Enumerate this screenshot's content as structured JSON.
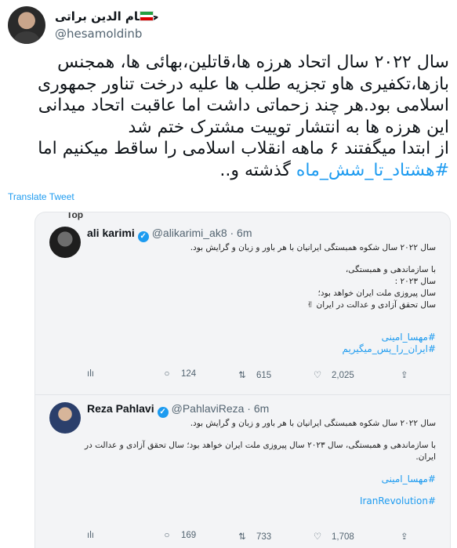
{
  "author": {
    "display_name": "حسام الدین براتی",
    "handle": "@hesamoldinb"
  },
  "tweet": {
    "lines": [
      "سال ۲۰۲۲ سال اتحاد هرزه ها،قاتلین،بهائی ها، همجنس",
      "بازها،تکفیری هاو تجزیه طلب ها علیه درخت تناور جمهوری",
      "اسلامی بود.هر چند زحماتی داشت اما عاقبت اتحاد میدانی",
      "این هرزه ها به انتشار توییت مشترک ختم شد",
      "از ابتدا میگفتند ۶ ماهه انقلاب اسلامی را ساقط میکنیم اما"
    ],
    "last_line_hashtag": "#هشتاد_تا_شش_ماه",
    "last_line_rest": " گذشته و..",
    "translate_label": "Translate Tweet"
  },
  "media": {
    "top_label": "Top",
    "quoted": [
      {
        "name": "ali karimi",
        "handle": "@alikarimi_ak8 · 6m",
        "body": [
          "سال ۲۰۲۲ سال شکوه همبستگی ایرانیان با هر باور و زبان و گرایش بود.",
          "",
          "با سازماندهی و همبستگی،",
          "سال ۲۰۲۳ :",
          "سال پیروزی ملت ایران خواهد بود؛",
          "سال تحقق آزادی و عدالت در ایران ✌"
        ],
        "tags": [
          "#مهسا_امینی",
          "#ایران_را_پس_میگیریم"
        ],
        "actions": {
          "replies": "",
          "retweets": "124",
          "likes": "615",
          "views": "2,025"
        }
      },
      {
        "name": "Reza Pahlavi",
        "handle": "@PahlaviReza · 6m",
        "body": [
          "سال ۲۰۲۲ سال شکوه همبستگی ایرانیان با هر باور و زبان و گرایش بود.",
          "",
          "با سازماندهی و همبستگی، سال ۲۰۲۳ سال پیروزی ملت ایران خواهد بود؛ سال تحقق آزادی و عدالت در",
          "ایران."
        ],
        "tags": [
          "#مهسا_امینی",
          "#IranRevolution"
        ],
        "actions": {
          "replies": "",
          "retweets": "169",
          "likes": "733",
          "views": "1,708"
        }
      }
    ]
  },
  "icons": {
    "reply": "reply-icon",
    "retweet": "retweet-icon",
    "like": "heart-icon",
    "views": "views-icon",
    "share": "share-icon",
    "verified": "verified-badge-icon"
  },
  "colors": {
    "accent": "#1d9bf0",
    "secondary_text": "#536471",
    "flag_green": "#239f40",
    "flag_red": "#da0000"
  }
}
